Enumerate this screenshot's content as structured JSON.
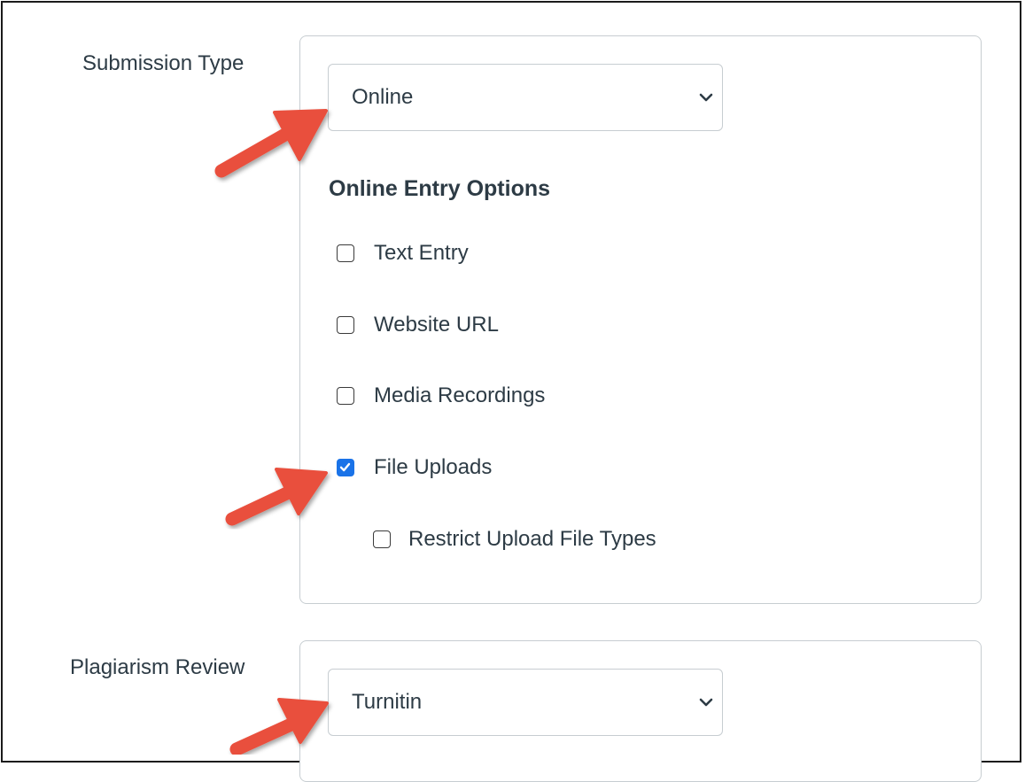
{
  "submission": {
    "label": "Submission Type",
    "select_value": "Online",
    "options_title": "Online Entry Options",
    "options": [
      {
        "label": "Text Entry",
        "checked": false
      },
      {
        "label": "Website URL",
        "checked": false
      },
      {
        "label": "Media Recordings",
        "checked": false
      },
      {
        "label": "File Uploads",
        "checked": true
      }
    ],
    "sub_option": {
      "label": "Restrict Upload File Types",
      "checked": false
    }
  },
  "plagiarism": {
    "label": "Plagiarism Review",
    "select_value": "Turnitin"
  },
  "colors": {
    "checkbox_checked": "#1a73e8",
    "annotation_arrow": "#e9503e",
    "text": "#2d3b45",
    "border": "#c7cdd1"
  },
  "icons": {
    "dropdown": "chevron-down-icon",
    "checked": "checkmark-icon",
    "annotation": "red-arrow-icon"
  }
}
